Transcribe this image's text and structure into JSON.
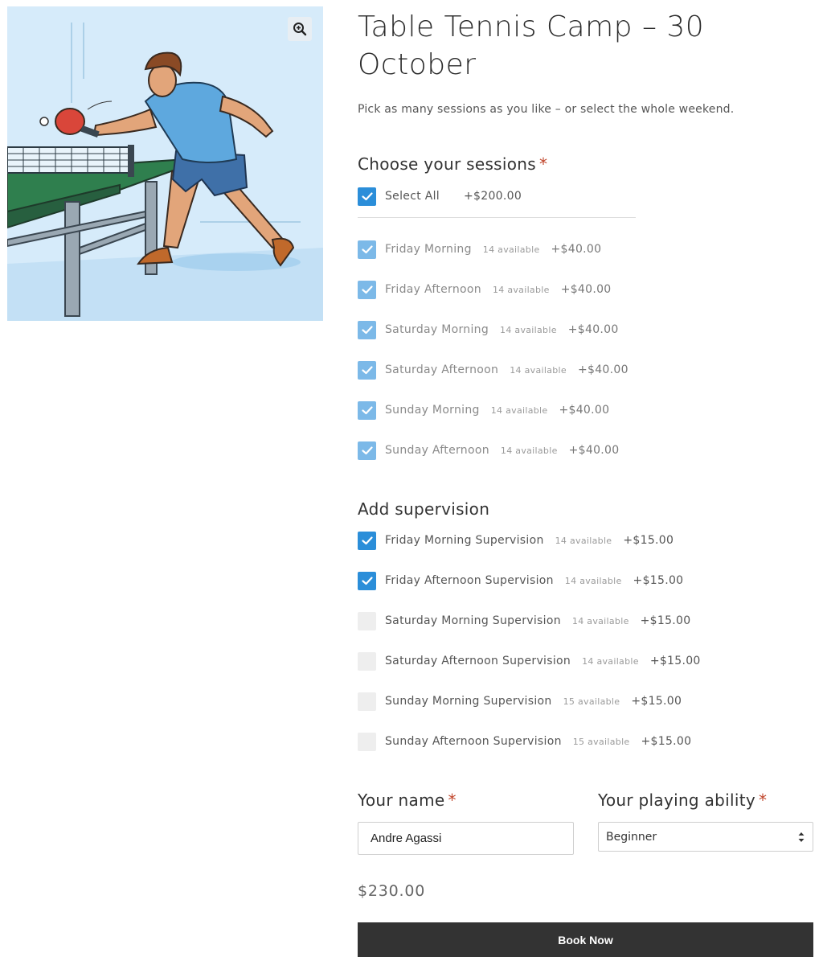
{
  "product": {
    "title": "Table Tennis Camp – 30 October",
    "intro": "Pick as many sessions as you like – or select the whole weekend.",
    "image_icon": "table-tennis-player-illustration",
    "zoom_icon": "zoom-in-icon"
  },
  "sessions": {
    "label": "Choose your sessions",
    "required_mark": "*",
    "select_all": {
      "label": "Select All",
      "price": "+$200.00",
      "checked": true
    },
    "items": [
      {
        "label": "Friday Morning",
        "available": "14 available",
        "price": "+$40.00",
        "checked": true
      },
      {
        "label": "Friday Afternoon",
        "available": "14 available",
        "price": "+$40.00",
        "checked": true
      },
      {
        "label": "Saturday Morning",
        "available": "14 available",
        "price": "+$40.00",
        "checked": true
      },
      {
        "label": "Saturday Afternoon",
        "available": "14 available",
        "price": "+$40.00",
        "checked": true
      },
      {
        "label": "Sunday Morning",
        "available": "14 available",
        "price": "+$40.00",
        "checked": true
      },
      {
        "label": "Sunday Afternoon",
        "available": "14 available",
        "price": "+$40.00",
        "checked": true
      }
    ]
  },
  "supervision": {
    "label": "Add supervision",
    "items": [
      {
        "label": "Friday Morning Supervision",
        "available": "14 available",
        "price": "+$15.00",
        "checked": true
      },
      {
        "label": "Friday Afternoon Supervision",
        "available": "14 available",
        "price": "+$15.00",
        "checked": true
      },
      {
        "label": "Saturday Morning Supervision",
        "available": "14 available",
        "price": "+$15.00",
        "checked": false
      },
      {
        "label": "Saturday Afternoon Supervision",
        "available": "14 available",
        "price": "+$15.00",
        "checked": false
      },
      {
        "label": "Sunday Morning Supervision",
        "available": "15 available",
        "price": "+$15.00",
        "checked": false
      },
      {
        "label": "Sunday Afternoon Supervision",
        "available": "15 available",
        "price": "+$15.00",
        "checked": false
      }
    ]
  },
  "form": {
    "name_label": "Your name",
    "name_value": "Andre Agassi",
    "ability_label": "Your playing ability",
    "ability_value": "Beginner",
    "required_mark": "*"
  },
  "total": "$230.00",
  "book_button": "Book Now",
  "colors": {
    "accent": "#2b8ed9",
    "required": "#c0452b",
    "button": "#333333"
  }
}
